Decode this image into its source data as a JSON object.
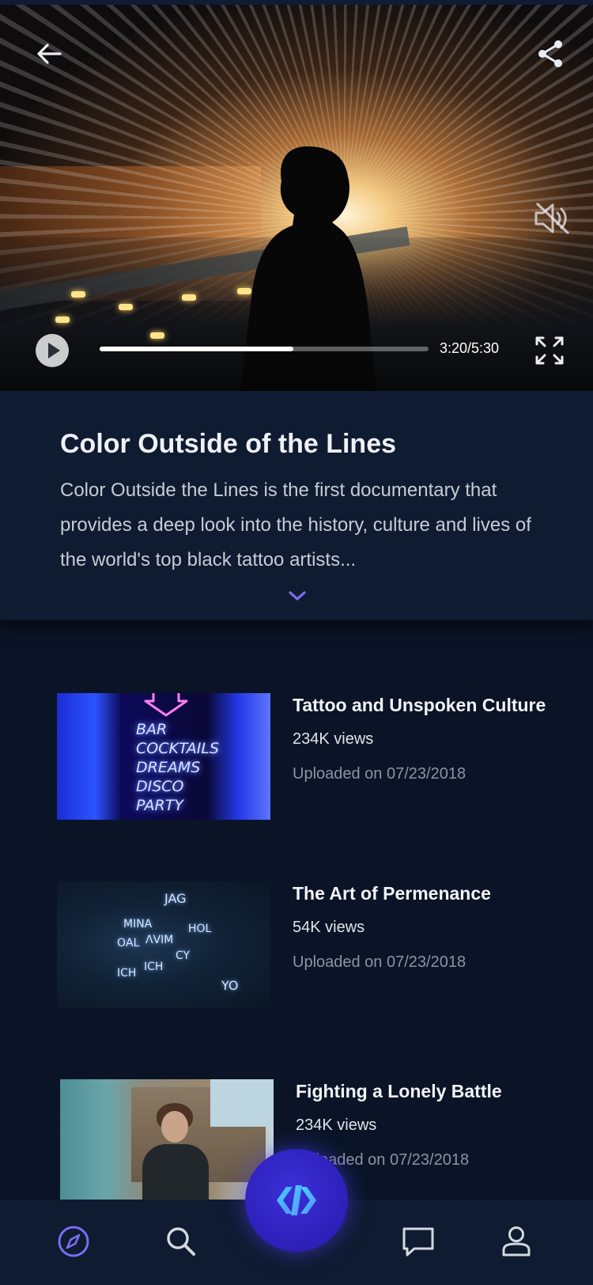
{
  "video": {
    "current_time": "3:20/5:30",
    "progress": 0.59
  },
  "info": {
    "title": "Color Outside of the Lines",
    "description": "Color Outside the Lines is the first documentary that provides a deep look into the history, culture and lives of the world's top black tattoo artists..."
  },
  "thumb1_sign": [
    "BAR",
    "COCKTAILS",
    "DREAMS",
    "DISCO",
    "PARTY"
  ],
  "list": [
    {
      "title": "Tattoo and Unspoken Culture",
      "views": "234K views",
      "date": "Uploaded on 07/23/2018"
    },
    {
      "title": "The Art of Permenance",
      "views": "54K views",
      "date": "Uploaded on 07/23/2018"
    },
    {
      "title": "Fighting a Lonely Battle",
      "views": "234K views",
      "date": "Uploaded on 07/23/2018"
    }
  ],
  "nav": {
    "items": [
      "compass-icon",
      "search-icon",
      "app-logo-icon",
      "chat-icon",
      "profile-icon"
    ],
    "active": "compass-icon"
  },
  "colors": {
    "background": "#0a1426",
    "card": "#0e1b30",
    "accent": "#7b6cf2",
    "fab": "#2d1fb8",
    "logo_gradient_start": "#3fd8ff",
    "logo_gradient_end": "#5b8cff"
  }
}
